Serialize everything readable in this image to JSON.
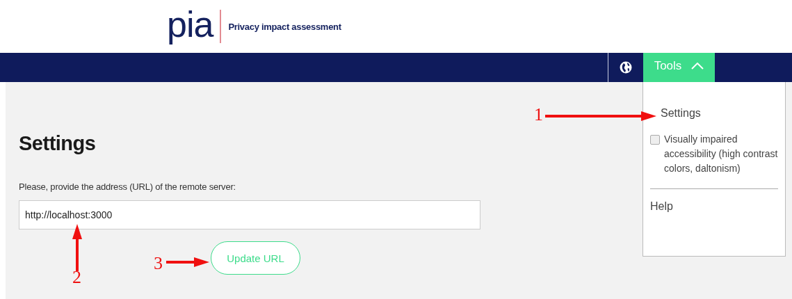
{
  "header": {
    "logo": "pia",
    "tagline": "Privacy impact assessment"
  },
  "navbar": {
    "items": [
      {
        "kind": "globe"
      },
      {
        "kind": "menu",
        "label": "Tools",
        "expanded": true
      }
    ]
  },
  "dropdown": {
    "items": [
      {
        "kind": "link",
        "label": "Settings"
      },
      {
        "kind": "checkbox",
        "label": "Visually impaired accessibility (high contrast colors, daltonism)",
        "checked": false
      },
      {
        "kind": "divider"
      },
      {
        "kind": "link",
        "label": "Help"
      }
    ]
  },
  "page": {
    "title": "Settings",
    "field_label": "Please, provide the address (URL) of the remote server:",
    "url_field": {
      "value": "http://localhost:3000"
    },
    "button": "Update URL"
  },
  "annotations": [
    {
      "label": "1"
    },
    {
      "label": "2"
    },
    {
      "label": "3"
    }
  ]
}
